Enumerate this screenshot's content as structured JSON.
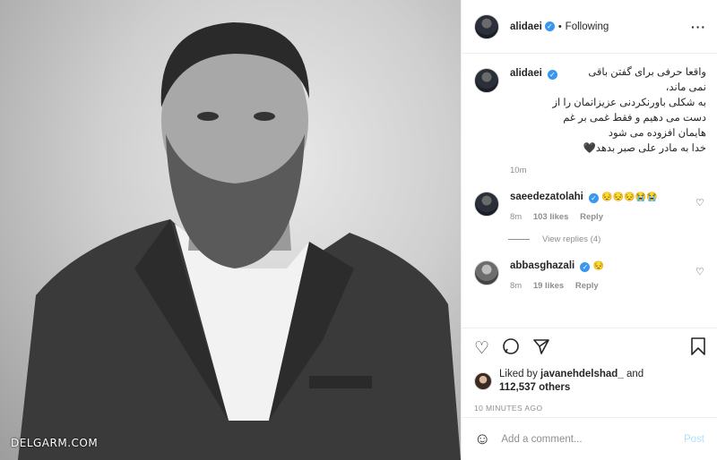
{
  "photo": {
    "watermark": "DELGARM.COM"
  },
  "header": {
    "username": "alidaei",
    "separator": "•",
    "follow_status": "Following",
    "more_icon": "more-horizontal-icon"
  },
  "caption": {
    "username": "alidaei",
    "lines": [
      "واقعا حرفی برای گفتن باقی",
      "نمی ماند،",
      "به شکلی باورنکردنی عزیزانمان را از",
      "دست می دهیم و فقط غمی بر غم",
      "هایمان افزوده می شود",
      "خدا به مادر علی صبر بدهد🖤"
    ],
    "time": "10m"
  },
  "comments": [
    {
      "username": "saeedezatolahi",
      "text": "😔😔😔😭😭",
      "time": "8m",
      "likes": "103 likes",
      "reply": "Reply",
      "view_replies": "View replies (4)"
    },
    {
      "username": "abbasghazali",
      "text": "😔",
      "time": "8m",
      "likes": "19 likes",
      "reply": "Reply"
    }
  ],
  "actions": {
    "like_icon": "heart-icon",
    "comment_icon": "comment-icon",
    "share_icon": "share-icon",
    "save_icon": "bookmark-icon"
  },
  "likes": {
    "prefix": "Liked by",
    "user": "javanehdelshad_",
    "and": "and",
    "count": "112,537 others"
  },
  "timeago": "10 MINUTES AGO",
  "add_comment": {
    "placeholder": "Add a comment...",
    "post_label": "Post"
  },
  "colors": {
    "verified": "#3897f0",
    "post_disabled": "#b2dffc",
    "meta_gray": "#8e8e8e"
  }
}
